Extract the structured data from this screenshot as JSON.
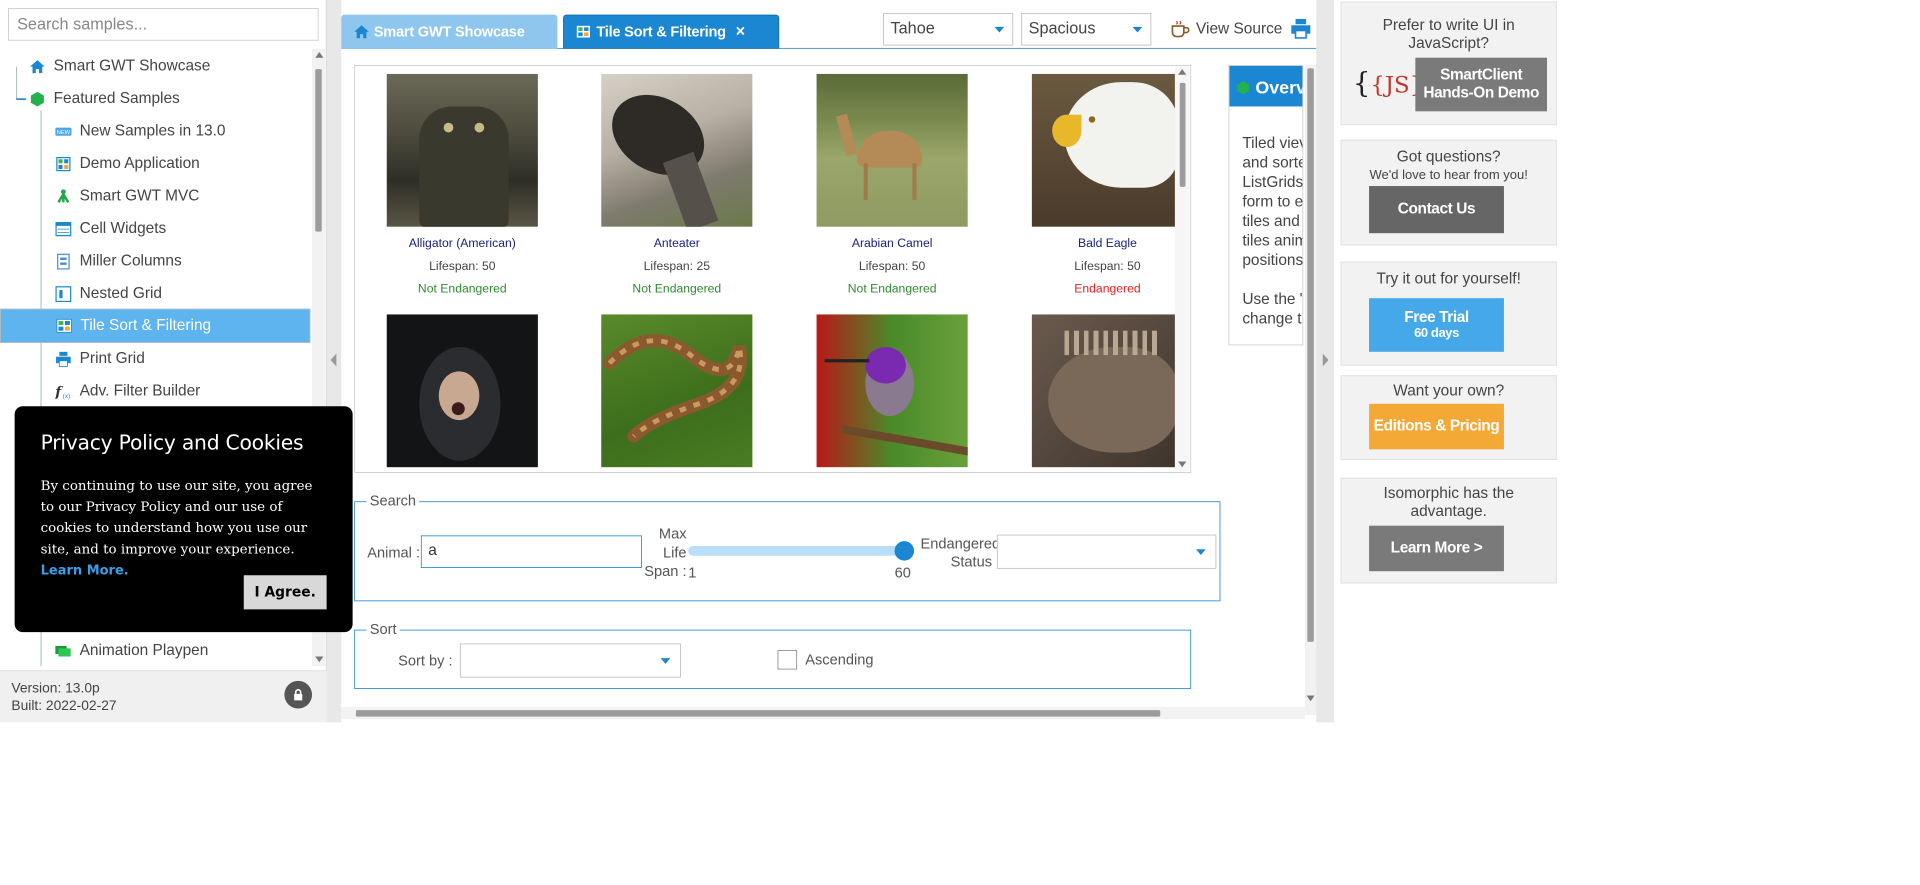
{
  "nav": {
    "search_placeholder": "Search samples...",
    "items": [
      {
        "label": "Smart GWT Showcase",
        "icon": "home-icon"
      },
      {
        "label": "Featured Samples",
        "icon": "cube-icon"
      },
      {
        "label": "New Samples in 13.0",
        "icon": "new-badge-icon"
      },
      {
        "label": "Demo Application",
        "icon": "grid-icon"
      },
      {
        "label": "Smart GWT MVC",
        "icon": "tree-figure-icon"
      },
      {
        "label": "Cell Widgets",
        "icon": "list-icon"
      },
      {
        "label": "Miller Columns",
        "icon": "columns-icon"
      },
      {
        "label": "Nested Grid",
        "icon": "nested-grid-icon"
      },
      {
        "label": "Tile Sort & Filtering",
        "icon": "tiles-icon"
      },
      {
        "label": "Print Grid",
        "icon": "printer-icon"
      },
      {
        "label": "Adv. Filter Builder",
        "icon": "function-icon"
      },
      {
        "label": "Animation Playpen",
        "icon": "animation-icon"
      }
    ],
    "version": "Version: 13.0p",
    "built": "Built: 2022-02-27"
  },
  "tabs": {
    "showcase": "Smart GWT Showcase",
    "current": "Tile Sort & Filtering",
    "close": "×"
  },
  "toolbar": {
    "skin": "Tahoe",
    "density": "Spacious",
    "view_source": "View Source"
  },
  "tiles": [
    {
      "name": "Alligator (American)",
      "lifespan": "Lifespan: 50",
      "status": "Not Endangered"
    },
    {
      "name": "Anteater",
      "lifespan": "Lifespan: 25",
      "status": "Not Endangered"
    },
    {
      "name": "Arabian Camel",
      "lifespan": "Lifespan: 50",
      "status": "Not Endangered"
    },
    {
      "name": "Bald Eagle",
      "lifespan": "Lifespan: 50",
      "status": "Endangered"
    },
    {
      "name": "",
      "lifespan": "",
      "status": ""
    },
    {
      "name": "",
      "lifespan": "",
      "status": ""
    },
    {
      "name": "",
      "lifespan": "",
      "status": ""
    },
    {
      "name": "",
      "lifespan": "",
      "status": ""
    }
  ],
  "colors": {
    "not_endangered": "#2e8b2e",
    "endangered": "#e02020",
    "accent": "#1b86d2"
  },
  "overview": {
    "title": "Overvi",
    "lines": [
      "Tiled viev",
      "and sorte",
      "ListGrids",
      "form to e",
      "tiles and",
      "tiles anim",
      "positions"
    ],
    "lines2": [
      "Use the \"",
      "change t"
    ]
  },
  "search": {
    "legend": "Search",
    "animal_label": "Animal :",
    "animal_value": "a",
    "maxlife_label": [
      "Max",
      "Life",
      "Span :"
    ],
    "slider_min": "1",
    "slider_max": "60",
    "slider_value": 60,
    "status_label": [
      "Endangered",
      "Status :"
    ],
    "status_value": ""
  },
  "sort": {
    "legend": "Sort",
    "sortby_label": "Sort by :",
    "sortby_value": "",
    "ascending_label": "Ascending"
  },
  "ads": [
    {
      "title": [
        "Prefer to write UI in",
        "JavaScript?"
      ],
      "button": [
        "SmartClient",
        "Hands-On Demo"
      ],
      "button_color": "#7a7a7a",
      "logo": "{JS}"
    },
    {
      "title": [
        "Got questions?"
      ],
      "subtitle": "We'd love to hear from you!",
      "button": [
        "Contact Us"
      ],
      "button_color": "#666666"
    },
    {
      "title": [
        "Try it out for yourself!"
      ],
      "button": [
        "Free Trial",
        "60 days"
      ],
      "button_color": "#45a8e8"
    },
    {
      "title": [
        "Want your own?"
      ],
      "button": [
        "Editions & Pricing"
      ],
      "button_color": "#f4a836"
    },
    {
      "title": [
        "Isomorphic has the",
        "advantage."
      ],
      "button": [
        "Learn More >"
      ],
      "button_color": "#7a7a7a"
    }
  ],
  "privacy": {
    "title": "Privacy Policy and Cookies",
    "body": "By continuing to use our site, you agree to our Privacy Policy and our use of cookies to understand how you use our site, and to improve your experience.",
    "link": "Learn More.",
    "agree": "I Agree."
  }
}
